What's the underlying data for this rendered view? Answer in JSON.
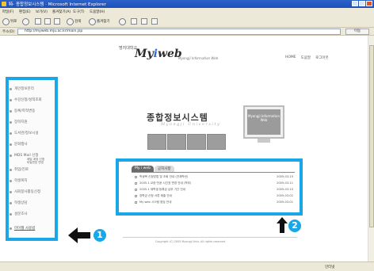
{
  "window": {
    "title": "特· 종합정보시스템 · Microsoft Internet Explorer"
  },
  "menu": [
    "파일(F)",
    "편집(E)",
    "보기(V)",
    "즐겨찾기(A)",
    "도구(T)",
    "도움말(H)"
  ],
  "toolbar": {
    "back_label": "뒤로",
    "search_label": "검색",
    "favorites_label": "즐겨찾기"
  },
  "address": {
    "label": "주소(D)",
    "url": "http://myweb.mju.ac.kr/main.jsp",
    "go_label": "이동"
  },
  "header": {
    "university": "명지대학교",
    "brand_prefix": "My",
    "brand_i": "i",
    "brand_suffix": "web",
    "brand_sub": "Myongji Information Web",
    "links": [
      "HOME",
      "도움말",
      "로그아웃"
    ]
  },
  "sidebar": {
    "items": [
      "개인정보관리",
      "수강신청/성적조회",
      "등록/학적변동",
      "장학지원",
      "도서관/정보시설",
      "문화행사",
      "MDS Mail 신청",
      "취업/진로",
      "학생복지",
      "사회봉사활동신청",
      "학생상담",
      "설문조사"
    ],
    "sub_lines": [
      "메일 계정 신청",
      "비밀번호 변경"
    ],
    "bottom_link": "마이웹 사용법"
  },
  "main": {
    "title_ko": "종합정보시스템",
    "title_en": "Myongji University",
    "monitor_text": "Myongji Information Web"
  },
  "notices": {
    "tab_active": "My i web",
    "tab_inactive": "공지사항",
    "rows": [
      {
        "text": "학생복 신청방법 및 조회 안내 (전체학년)",
        "date": "2005-03-15"
      },
      {
        "text": "2005-1 교양·전공 시간표 변경 안내 (학부)",
        "date": "2005-03-11"
      },
      {
        "text": "2005-1 재학생 등록금 납부 기간 안내",
        "date": "2005-03-10"
      },
      {
        "text": "장학금 신청 서류 제출 안내",
        "date": "2005-03-02"
      },
      {
        "text": "My web 시스템 점검 안내",
        "date": "2005-03-01"
      }
    ]
  },
  "annotations": {
    "badge1": "1",
    "badge2": "2"
  },
  "footer": {
    "copyright": "Copyright (C) 2005 Myongji Univ. All rights reserved."
  },
  "status": {
    "zone": "인터넷"
  },
  "colors": {
    "highlight": "#1aa7e8",
    "ie_title": "#2c62c9"
  },
  "icons": [
    "back-icon",
    "forward-icon",
    "stop-icon",
    "refresh-icon",
    "home-icon",
    "search-icon",
    "favorites-icon",
    "arrow-left-icon",
    "arrow-up-icon"
  ]
}
